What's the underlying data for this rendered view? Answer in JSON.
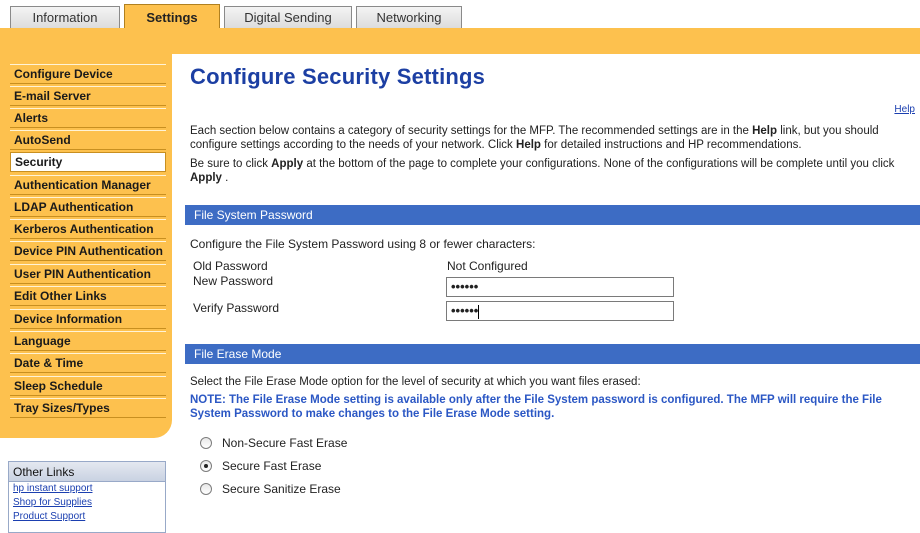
{
  "tabs": [
    {
      "label": "Information",
      "active": false
    },
    {
      "label": "Settings",
      "active": true
    },
    {
      "label": "Digital Sending",
      "active": false
    },
    {
      "label": "Networking",
      "active": false
    }
  ],
  "sidebar": {
    "items": [
      {
        "label": "Configure Device"
      },
      {
        "label": "E-mail Server"
      },
      {
        "label": "Alerts"
      },
      {
        "label": "AutoSend"
      },
      {
        "label": "Security",
        "active": true
      },
      {
        "label": "Authentication Manager"
      },
      {
        "label": "LDAP Authentication"
      },
      {
        "label": "Kerberos Authentication"
      },
      {
        "label": "Device PIN Authentication"
      },
      {
        "label": "User PIN Authentication"
      },
      {
        "label": "Edit Other Links"
      },
      {
        "label": "Device Information"
      },
      {
        "label": "Language"
      },
      {
        "label": "Date & Time"
      },
      {
        "label": "Sleep Schedule"
      },
      {
        "label": "Tray Sizes/Types"
      }
    ]
  },
  "other_links": {
    "title": "Other Links",
    "links": [
      "hp instant support",
      "Shop for Supplies",
      "Product Support"
    ]
  },
  "main": {
    "title": "Configure Security Settings",
    "help": "Help",
    "intro_1": {
      "a": "Each section below contains a category of security settings for the MFP. The recommended settings are in the ",
      "b": "Help",
      "c": " link, but you should configure settings according to the needs of your network. Click ",
      "d": "Help",
      "e": " for detailed instructions and HP recommendations."
    },
    "intro_2": {
      "a": "Be sure to click ",
      "b": "Apply",
      "c": " at the bottom of the page to complete your configurations. None of the configurations will be complete until you click ",
      "d": "Apply",
      "e": " ."
    },
    "fs_password": {
      "header": "File System Password",
      "instruction": "Configure the File System Password using 8 or fewer characters:",
      "old_label": "Old Password",
      "old_value": "Not Configured",
      "new_label": "New Password",
      "new_value": "••••••",
      "verify_label": "Verify Password",
      "verify_value": "••••••"
    },
    "erase_mode": {
      "header": "File Erase Mode",
      "instruction": "Select the File Erase Mode option for the level of security at which you want files erased:",
      "note": "NOTE: The File Erase Mode setting is available only after the File System password is configured. The MFP will require the File System Password to make changes to the File Erase Mode setting.",
      "options": [
        {
          "label": "Non-Secure Fast Erase",
          "checked": false
        },
        {
          "label": "Secure Fast Erase",
          "checked": true
        },
        {
          "label": "Secure Sanitize Erase",
          "checked": false
        }
      ]
    }
  }
}
